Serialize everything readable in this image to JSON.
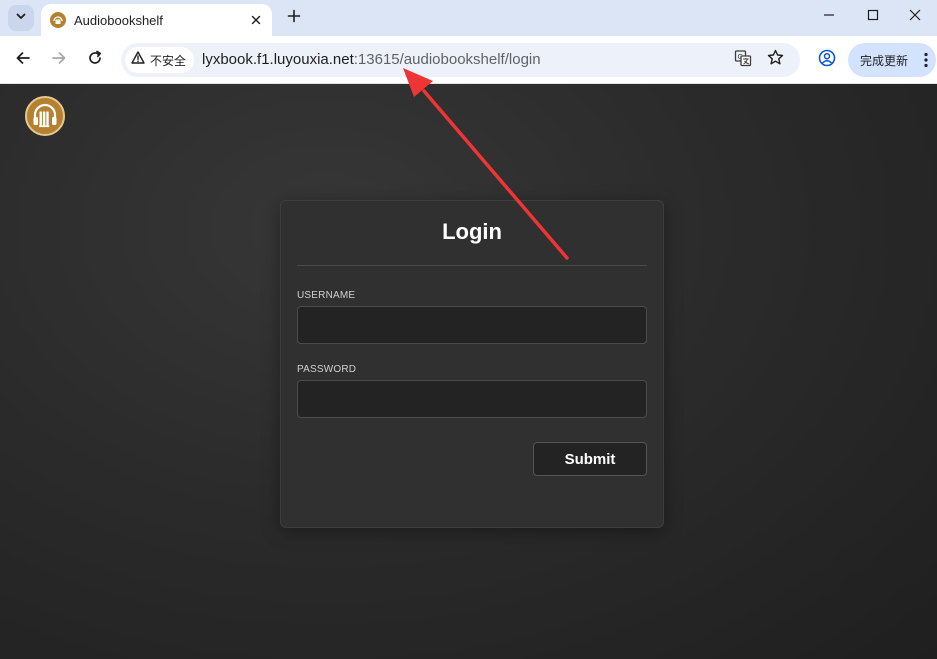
{
  "browser": {
    "tab": {
      "title": "Audiobookshelf"
    },
    "address_bar": {
      "security_label": "不安全",
      "url_host": "lyxbook.f1.luyouxia.net",
      "url_rest": ":13615/audiobookshelf/login"
    },
    "update_button_label": "完成更新"
  },
  "login": {
    "title": "Login",
    "username_label": "USERNAME",
    "username_value": "",
    "password_label": "PASSWORD",
    "password_value": "",
    "submit_label": "Submit"
  },
  "colors": {
    "brand": "#b3812f",
    "annotation_arrow": "#ee3434",
    "page_background": "#2b2b2b"
  },
  "icons": {
    "tab_search": "chevron-down-icon",
    "favicon": "audiobookshelf-icon",
    "tab_close": "close-icon",
    "new_tab": "plus-icon",
    "back": "arrow-left-icon",
    "forward": "arrow-right-icon",
    "reload": "reload-icon",
    "security": "warning-triangle-icon",
    "translate": "translate-icon",
    "bookmark": "star-icon",
    "profile": "profile-icon",
    "menu": "kebab-menu-icon",
    "logo": "audiobookshelf-icon"
  }
}
